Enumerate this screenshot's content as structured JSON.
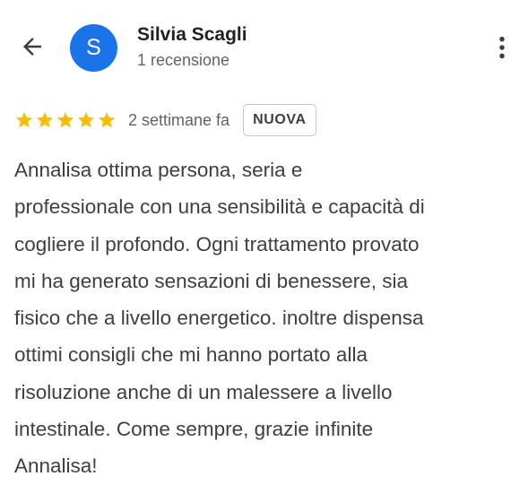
{
  "header": {
    "back_icon": "arrow-back-icon",
    "avatar_initial": "S",
    "avatar_color": "#1a73e8",
    "reviewer_name": "Silvia Scagli",
    "reviewer_review_count": "1 recensione",
    "more_icon": "more-vert-icon"
  },
  "review": {
    "rating": 5,
    "rating_max": 5,
    "star_color": "#fbbc04",
    "date": "2 settimane fa",
    "badge": "NUOVA",
    "text_lines": [
      "Annalisa ottima persona, seria e",
      "professionale con una sensibilità e capacità di",
      "cogliere il profondo. Ogni trattamento provato",
      "mi ha generato sensazioni di benessere, sia",
      "fisico che a livello energetico. inoltre dispensa",
      "ottimi consigli che mi hanno portato alla",
      "risoluzione anche di un malessere a livello",
      "intestinale. Come sempre, grazie infinite",
      "Annalisa!"
    ]
  }
}
